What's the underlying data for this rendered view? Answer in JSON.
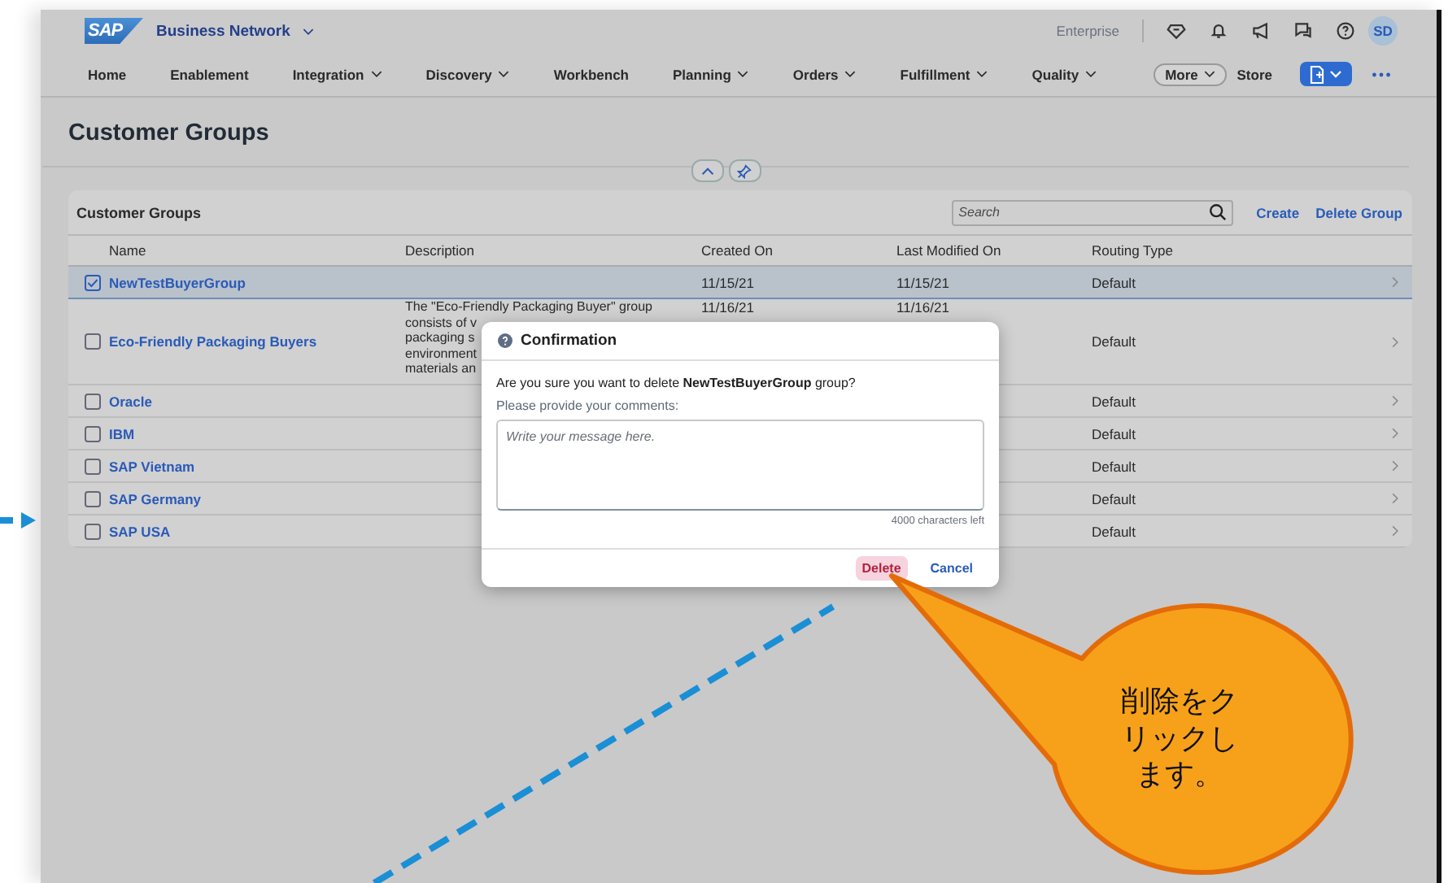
{
  "shell": {
    "logo": "SAP",
    "product": "Business Network",
    "enterprise": "Enterprise",
    "avatar": "SD",
    "store": "Store",
    "more": "More",
    "nav": [
      {
        "label": "Home",
        "dropdown": false
      },
      {
        "label": "Enablement",
        "dropdown": false
      },
      {
        "label": "Integration",
        "dropdown": true
      },
      {
        "label": "Discovery",
        "dropdown": true
      },
      {
        "label": "Workbench",
        "dropdown": false
      },
      {
        "label": "Planning",
        "dropdown": true
      },
      {
        "label": "Orders",
        "dropdown": true
      },
      {
        "label": "Fulfillment",
        "dropdown": true
      },
      {
        "label": "Quality",
        "dropdown": true
      }
    ]
  },
  "page_title": "Customer Groups",
  "table": {
    "title": "Customer Groups",
    "search_placeholder": "Search",
    "actions": [
      "Create",
      "Delete Group"
    ],
    "columns": [
      "Name",
      "Description",
      "Created On",
      "Last Modified On",
      "Routing Type"
    ],
    "rows": [
      {
        "name": "NewTestBuyerGroup",
        "selected": true,
        "created_on": "11/15/21",
        "last_modified_on": "11/15/21",
        "routing_type": "Default"
      },
      {
        "name": "Eco-Friendly Packaging Buyers",
        "selected": false,
        "description": [
          "The \"Eco-Friendly Packaging Buyer\" group",
          "consists of v",
          "packaging s",
          "environment",
          "materials an"
        ],
        "created_on": "11/16/21",
        "last_modified_on": "11/16/21",
        "routing_type": "Default"
      },
      {
        "name": "Oracle",
        "selected": false,
        "routing_type": "Default"
      },
      {
        "name": "IBM",
        "selected": false,
        "routing_type": "Default"
      },
      {
        "name": "SAP Vietnam",
        "selected": false,
        "routing_type": "Default"
      },
      {
        "name": "SAP Germany",
        "selected": false,
        "routing_type": "Default"
      },
      {
        "name": "SAP USA",
        "selected": false,
        "routing_type": "Default"
      }
    ]
  },
  "dialog": {
    "title": "Confirmation",
    "message": "Are you sure you want to delete **NewTestBuyerGroup** group?",
    "comment_label": "Please provide your comments:",
    "placeholder": "Write your message here.",
    "counter": "4000 characters left",
    "buttons": [
      {
        "label": "Delete",
        "kind": "danger"
      },
      {
        "label": "Cancel",
        "kind": "transparent"
      }
    ]
  },
  "callout": {
    "text": "削除をクリックします。"
  }
}
